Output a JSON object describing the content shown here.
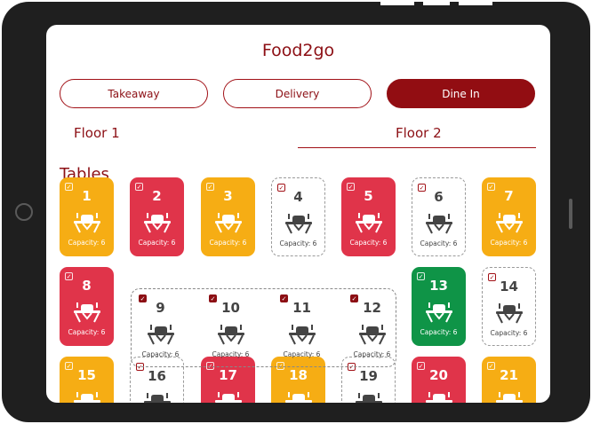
{
  "app": {
    "title": "Food2go"
  },
  "modes": [
    {
      "label": "Takeaway",
      "active": false
    },
    {
      "label": "Delivery",
      "active": false
    },
    {
      "label": "Dine In",
      "active": true
    }
  ],
  "floors": [
    {
      "label": "Floor 1",
      "selected": false
    },
    {
      "label": "Floor 2",
      "selected": true
    }
  ],
  "section_title": "Tables",
  "check_glyph": "✓",
  "status_colors": {
    "reserved": "#f6ad14",
    "occupied": "#e0344a",
    "available": "#0f9447",
    "free": "#ffffff",
    "brand": "#8c0f14"
  },
  "tables": [
    {
      "number": "1",
      "capacity": "Capacity: 6",
      "status": "yellow",
      "icon": "dining-table-icon"
    },
    {
      "number": "2",
      "capacity": "Capacity: 6",
      "status": "red",
      "icon": "dining-table-icon"
    },
    {
      "number": "3",
      "capacity": "Capacity: 6",
      "status": "yellow",
      "icon": "dining-table-icon"
    },
    {
      "number": "4",
      "capacity": "Capacity: 6",
      "status": "empty",
      "icon": "dining-table-icon"
    },
    {
      "number": "5",
      "capacity": "Capacity: 6",
      "status": "red",
      "icon": "dining-table-icon"
    },
    {
      "number": "6",
      "capacity": "Capacity: 6",
      "status": "empty",
      "icon": "dining-table-icon"
    },
    {
      "number": "7",
      "capacity": "Capacity: 6",
      "status": "yellow",
      "icon": "dining-table-icon"
    },
    {
      "number": "8",
      "capacity": "Capacity: 6",
      "status": "red",
      "icon": "dining-table-icon"
    },
    {
      "number": "9",
      "capacity": "Capacity: 6",
      "status": "grouped",
      "icon": "dining-table-icon"
    },
    {
      "number": "10",
      "capacity": "Capacity: 6",
      "status": "grouped",
      "icon": "dining-table-icon"
    },
    {
      "number": "11",
      "capacity": "Capacity: 6",
      "status": "grouped",
      "icon": "dining-table-icon"
    },
    {
      "number": "12",
      "capacity": "Capacity: 6",
      "status": "grouped",
      "icon": "dining-table-icon"
    },
    {
      "number": "13",
      "capacity": "Capacity: 6",
      "status": "green",
      "icon": "dining-table-icon"
    },
    {
      "number": "14",
      "capacity": "Capacity: 6",
      "status": "empty",
      "icon": "dining-table-icon"
    },
    {
      "number": "15",
      "capacity": "",
      "status": "yellow",
      "icon": "dining-table-icon"
    },
    {
      "number": "16",
      "capacity": "",
      "status": "empty",
      "icon": "dining-table-icon"
    },
    {
      "number": "17",
      "capacity": "",
      "status": "red",
      "icon": "dining-table-icon"
    },
    {
      "number": "18",
      "capacity": "",
      "status": "yellow",
      "icon": "dining-table-icon"
    },
    {
      "number": "19",
      "capacity": "",
      "status": "empty",
      "icon": "dining-table-icon"
    },
    {
      "number": "20",
      "capacity": "",
      "status": "red",
      "icon": "dining-table-icon"
    },
    {
      "number": "21",
      "capacity": "",
      "status": "yellow",
      "icon": "dining-table-icon"
    }
  ]
}
